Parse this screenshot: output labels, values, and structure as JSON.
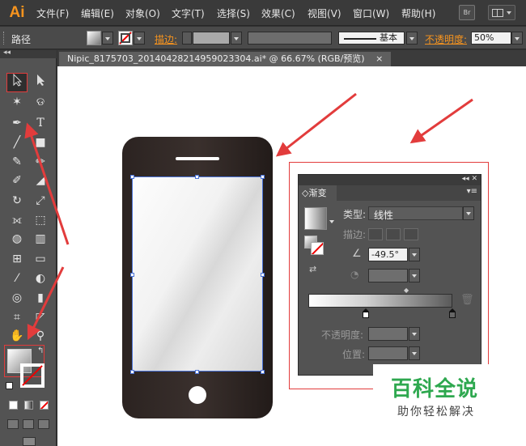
{
  "menubar": {
    "logo": "Ai",
    "items": [
      "文件(F)",
      "编辑(E)",
      "对象(O)",
      "文字(T)",
      "选择(S)",
      "效果(C)",
      "视图(V)",
      "窗口(W)",
      "帮助(H)"
    ],
    "bridge_label": "Br"
  },
  "controlbar": {
    "selection_label": "路径",
    "stroke_label": "描边:",
    "brush_label": "基本",
    "opacity_label": "不透明度:",
    "opacity_value": "50%"
  },
  "document": {
    "tab_title": "Nipic_8175703_20140428214959023304.ai* @ 66.67% (RGB/预览)",
    "close_glyph": "×"
  },
  "gradient_panel": {
    "header_glyphs": "◂◂ ✕",
    "tab_label": "◇渐变",
    "menu_glyph": "▾≡",
    "type_label": "类型:",
    "type_value": "线性",
    "stroke_label": "描边:",
    "angle_value": "-49.5°",
    "opacity_label": "不透明度:",
    "location_label": "位置:"
  },
  "watermark": {
    "title": "百科全说",
    "subtitle": "助你轻松解决"
  },
  "colors": {
    "menubar_bg": "#3a3a3a",
    "panel_bg": "#535353",
    "annotation_red": "#e23c3c",
    "watermark_green": "#2ea84f",
    "selection_blue": "#4a72d6",
    "ai_orange": "#f7941e"
  }
}
